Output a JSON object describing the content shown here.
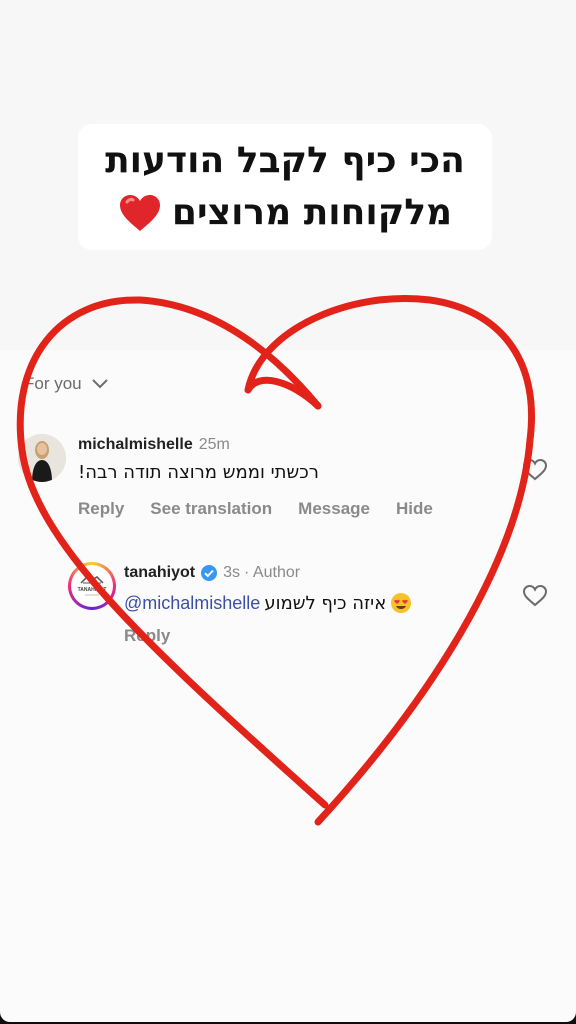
{
  "story": {
    "headline_line1": "הכי כיף לקבל הודעות",
    "headline_line2": "מלקוחות מרוצים",
    "headline_emoji": "red-heart-emoji"
  },
  "comments_panel": {
    "sort_label": "For you",
    "comments": [
      {
        "username": "michalmishelle",
        "time": "25m",
        "text": "רכשתי וממש מרוצה תודה רבה!",
        "actions": [
          "Reply",
          "See translation",
          "Message",
          "Hide"
        ]
      },
      {
        "username": "tanahiyot",
        "time": "3s",
        "badge": "· Author",
        "mention": "@michalmishelle",
        "text": "איזה כיף לשמוע",
        "actions": [
          "Reply"
        ]
      }
    ]
  },
  "avatar_logo_text": "TANAHIYOT",
  "colors": {
    "drawing_red": "#e2231a",
    "mention_blue": "#3b4fa8",
    "verified_blue": "#3897f0"
  }
}
